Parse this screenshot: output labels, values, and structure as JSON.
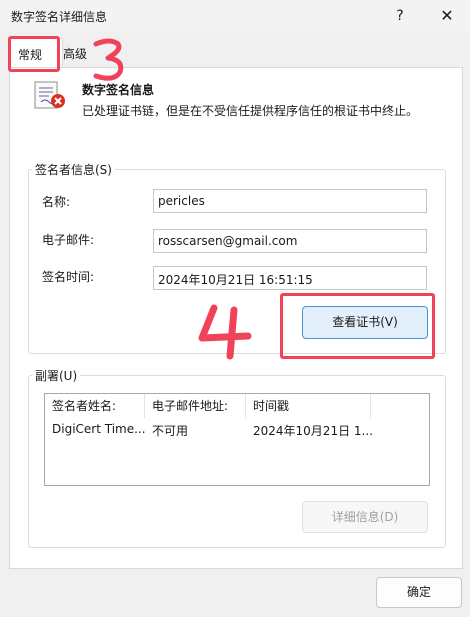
{
  "window": {
    "title": "数字签名详细信息",
    "help_glyph": "?",
    "close_glyph": "✕"
  },
  "tabs": [
    {
      "label": "常规",
      "selected": true
    },
    {
      "label": "高级",
      "selected": false
    }
  ],
  "info": {
    "icon": "certificate-error-icon",
    "title": "数字签名信息",
    "message": "已处理证书链，但是在不受信任提供程序信任的根证书中终止。"
  },
  "signer": {
    "legend": "签名者信息(S)",
    "name_label": "名称:",
    "name_value": "pericles",
    "email_label": "电子邮件:",
    "email_value": "rosscarsen@gmail.com",
    "time_label": "签名时间:",
    "time_value": "2024年10月21日 16:51:15",
    "view_cert_button": "查看证书(V)"
  },
  "countersignatures": {
    "legend": "副署(U)",
    "columns": [
      "签名者姓名:",
      "电子邮件地址:",
      "时间戳"
    ],
    "rows": [
      [
        "DigiCert Time...",
        "不可用",
        "2024年10月21日 1..."
      ]
    ],
    "details_button": "详细信息(D)",
    "details_enabled": false
  },
  "footer": {
    "ok_button": "确定"
  },
  "annotations": {
    "step_3": "3",
    "step_4": "4",
    "color": "#f0435a"
  }
}
